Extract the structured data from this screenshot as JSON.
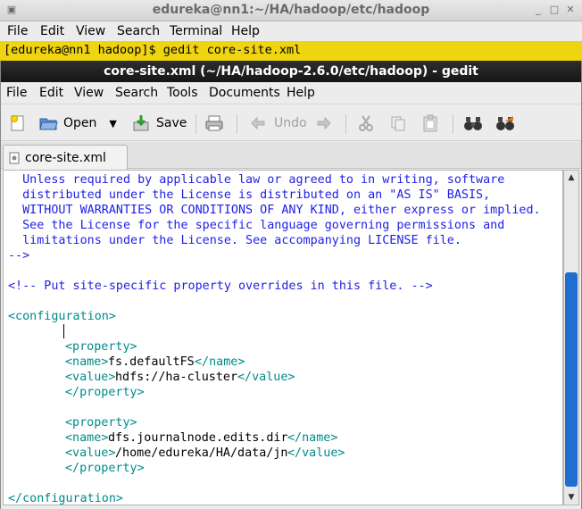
{
  "terminal": {
    "title": "edureka@nn1:~/HA/hadoop/etc/hadoop",
    "menu": [
      "File",
      "Edit",
      "View",
      "Search",
      "Terminal",
      "Help"
    ],
    "command_line": "[edureka@nn1 hadoop]$ gedit core-site.xml"
  },
  "gedit": {
    "title": "core-site.xml (~/HA/hadoop-2.6.0/etc/hadoop) - gedit",
    "menu": [
      "File",
      "Edit",
      "View",
      "Search",
      "Tools",
      "Documents",
      "Help"
    ],
    "toolbar": {
      "open_label": "Open",
      "save_label": "Save",
      "undo_label": "Undo"
    },
    "tab_label": "core-site.xml",
    "lines": [
      "  Unless required by applicable law or agreed to in writing, software",
      "  distributed under the License is distributed on an \"AS IS\" BASIS,",
      "  WITHOUT WARRANTIES OR CONDITIONS OF ANY KIND, either express or implied.",
      "  See the License for the specific language governing permissions and",
      "  limitations under the License. See accompanying LICENSE file.",
      "-->",
      "",
      "<!-- Put site-specific property overrides in this file. -->",
      "",
      "<configuration>",
      "",
      "<property>",
      "<name>",
      "fs.defaultFS",
      "</name>",
      "<value>",
      "hdfs://ha-cluster",
      "</value>",
      "</property>",
      "<property>",
      "<name>",
      "dfs.journalnode.edits.dir",
      "</name>",
      "<value>",
      "/home/edureka/HA/data/jn",
      "</value>",
      "</property>",
      "</configuration>"
    ]
  },
  "colors": {
    "terminal_highlight": "#efd410",
    "comment": "#1e1ee6",
    "tag": "#008a8a",
    "scroll_thumb": "#1f6fd0"
  }
}
